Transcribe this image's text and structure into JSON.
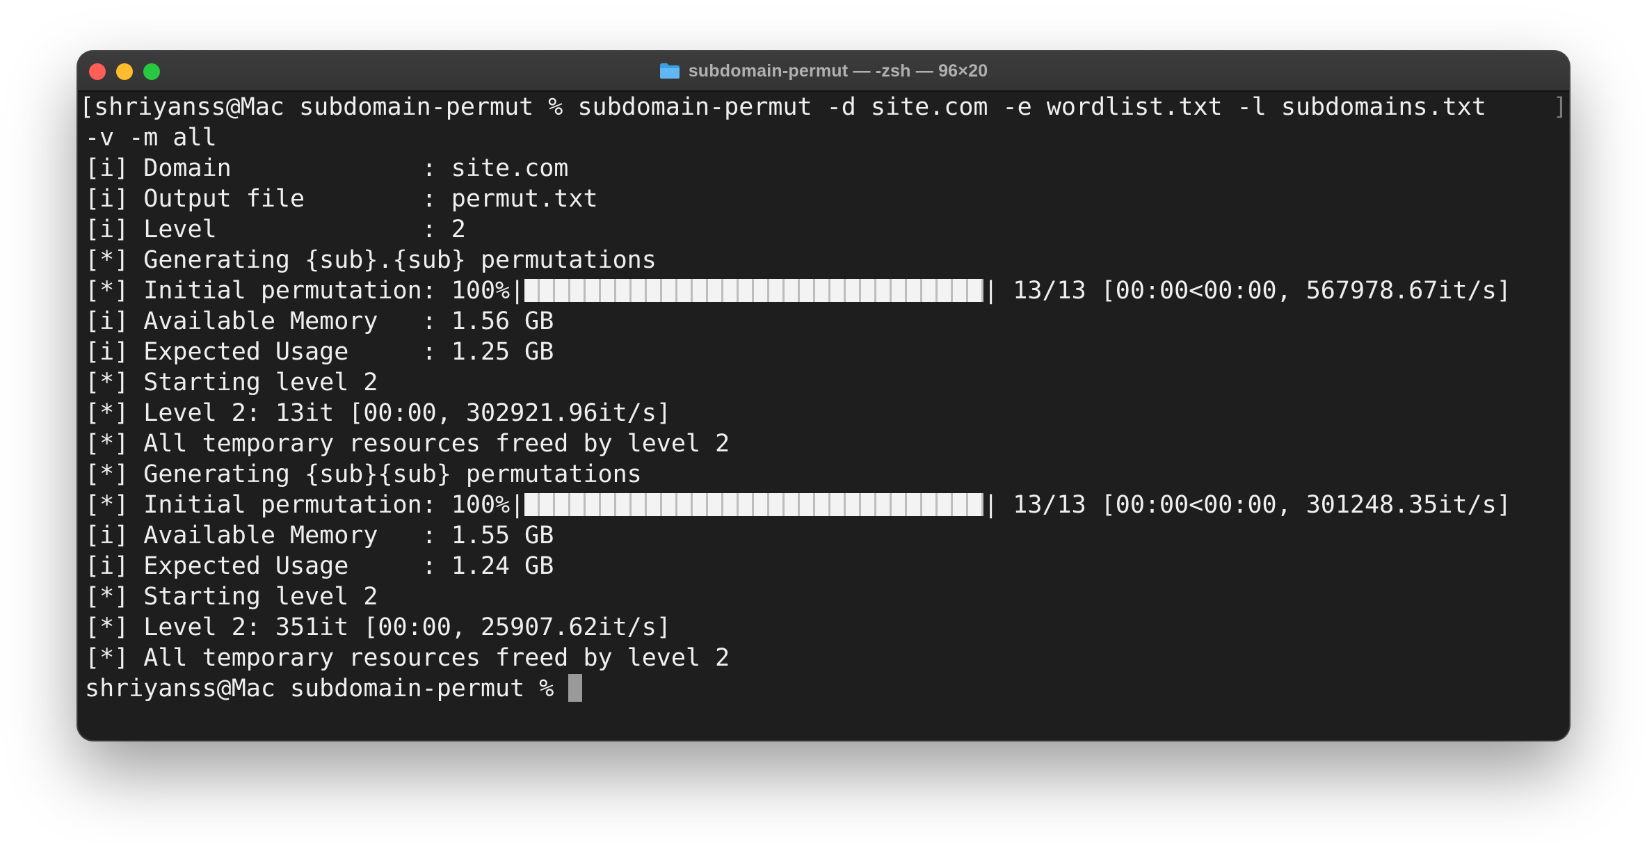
{
  "window": {
    "title": "subdomain-permut — -zsh — 96×20",
    "folder_icon": "folder-icon"
  },
  "terminal": {
    "command_prompt": "[shriyanss@Mac subdomain-permut % ",
    "command": "subdomain-permut -d site.com -e wordlist.txt -l subdomains.txt ",
    "command_cont": "-v -m all",
    "wrap_mark": "]",
    "lines": [
      "[i] Domain             : site.com",
      "[i] Output file        : permut.txt",
      "[i] Level              : 2",
      "[*] Generating {sub}.{sub} permutations"
    ],
    "progress1": {
      "prefix": "[*] Initial permutation: 100%|",
      "suffix": "| 13/13 [00:00<00:00, 567978.67it/s]",
      "percent": 100
    },
    "lines2": [
      "[i] Available Memory   : 1.56 GB",
      "[i] Expected Usage     : 1.25 GB",
      "[*] Starting level 2",
      "[*] Level 2: 13it [00:00, 302921.96it/s]",
      "[*] All temporary resources freed by level 2",
      "[*] Generating {sub}{sub} permutations"
    ],
    "progress2": {
      "prefix": "[*] Initial permutation: 100%|",
      "suffix": "| 13/13 [00:00<00:00, 301248.35it/s]",
      "percent": 100
    },
    "lines3": [
      "[i] Available Memory   : 1.55 GB",
      "[i] Expected Usage     : 1.24 GB",
      "[*] Starting level 2",
      "[*] Level 2: 351it [00:00, 25907.62it/s]",
      "[*] All temporary resources freed by level 2"
    ],
    "final_prompt": "shriyanss@Mac subdomain-permut % "
  },
  "colors": {
    "background": "#1e1e1e",
    "text": "#efefef",
    "close": "#ff5f57",
    "minimize": "#febc2e",
    "maximize": "#28c840"
  }
}
